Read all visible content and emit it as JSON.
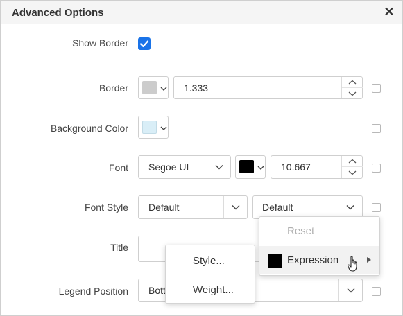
{
  "dialog": {
    "title": "Advanced Options",
    "close_glyph": "✕"
  },
  "rows": {
    "show_border": {
      "label": "Show Border",
      "checked": true
    },
    "border": {
      "label": "Border",
      "color": "#cccccc",
      "value": "1.333"
    },
    "background_color": {
      "label": "Background Color",
      "color": "#d9eef7"
    },
    "font": {
      "label": "Font",
      "family": "Segoe UI",
      "color": "#000000",
      "size": "10.667"
    },
    "font_style": {
      "label": "Font Style",
      "style_value": "Default",
      "weight_value": "Default"
    },
    "title": {
      "label": "Title",
      "value": ""
    },
    "legend_position": {
      "label": "Legend Position",
      "value": "Bott"
    }
  },
  "context_menu": {
    "items": [
      {
        "label": "Reset",
        "disabled": true
      },
      {
        "label": "Expression",
        "color": "#000000",
        "has_submenu": true
      }
    ]
  },
  "submenu": {
    "items": [
      {
        "label": "Style..."
      },
      {
        "label": "Weight..."
      }
    ]
  },
  "colors": {
    "accent": "#1a73e8",
    "border": "#cfcfcf",
    "titlebar_bg": "#f5f5f5"
  }
}
